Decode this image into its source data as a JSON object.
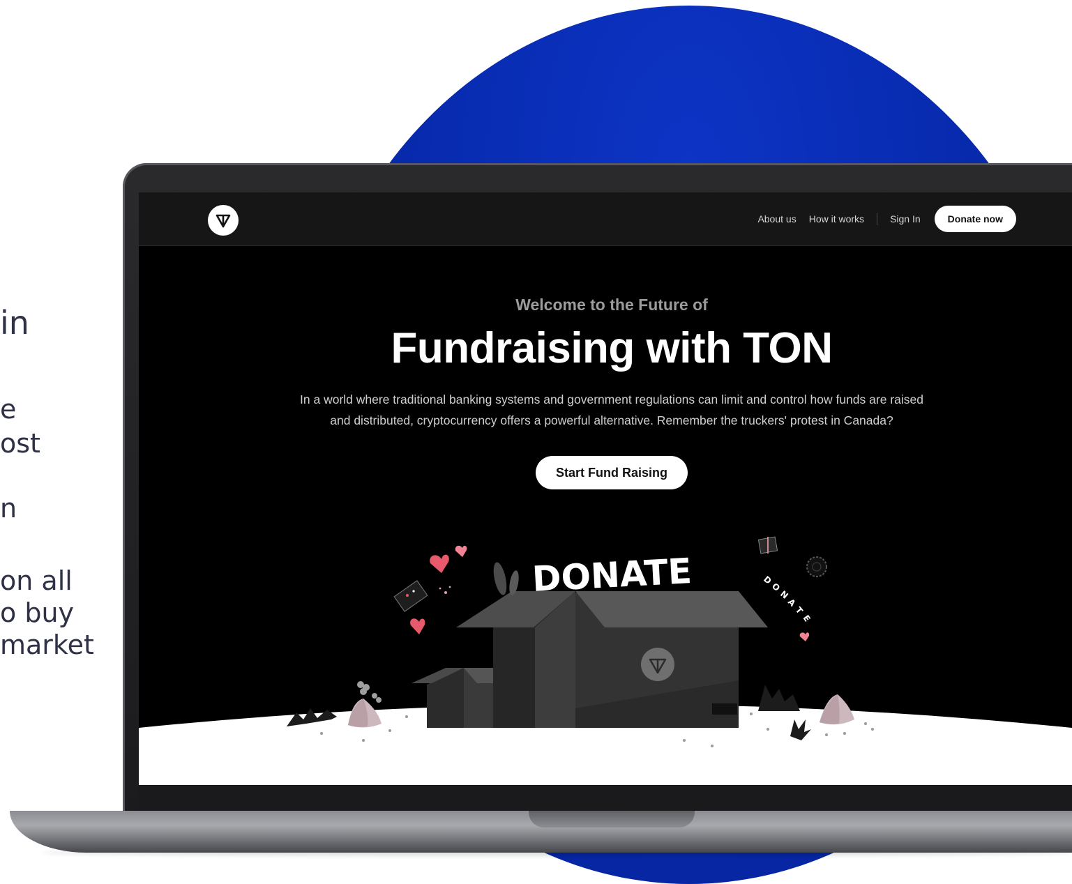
{
  "side_text": {
    "line1": "in",
    "line2": "e",
    "line3": "ost",
    "line4": "n",
    "line5": "on all",
    "line6": "o buy",
    "line7": "market"
  },
  "nav": {
    "links": [
      "About us",
      "How it works"
    ],
    "sign_in": "Sign In",
    "donate_button": "Donate now"
  },
  "hero": {
    "subtitle": "Welcome to the Future of",
    "title": "Fundraising with TON",
    "description_line1": "In a world where traditional banking systems and government regulations can limit and control how funds are raised",
    "description_line2": "and distributed, cryptocurrency offers a powerful alternative. Remember the truckers' protest in Canada?",
    "cta_label": "Start Fund Raising"
  },
  "illustration": {
    "big_word": "DONATE",
    "small_word_letters": [
      "D",
      "O",
      "N",
      "A",
      "T",
      "E"
    ]
  },
  "colors": {
    "accent_blue": "#0628a8",
    "screen_bg": "#000000",
    "nav_bg": "#161616",
    "heart_pink": "#e8596b"
  }
}
